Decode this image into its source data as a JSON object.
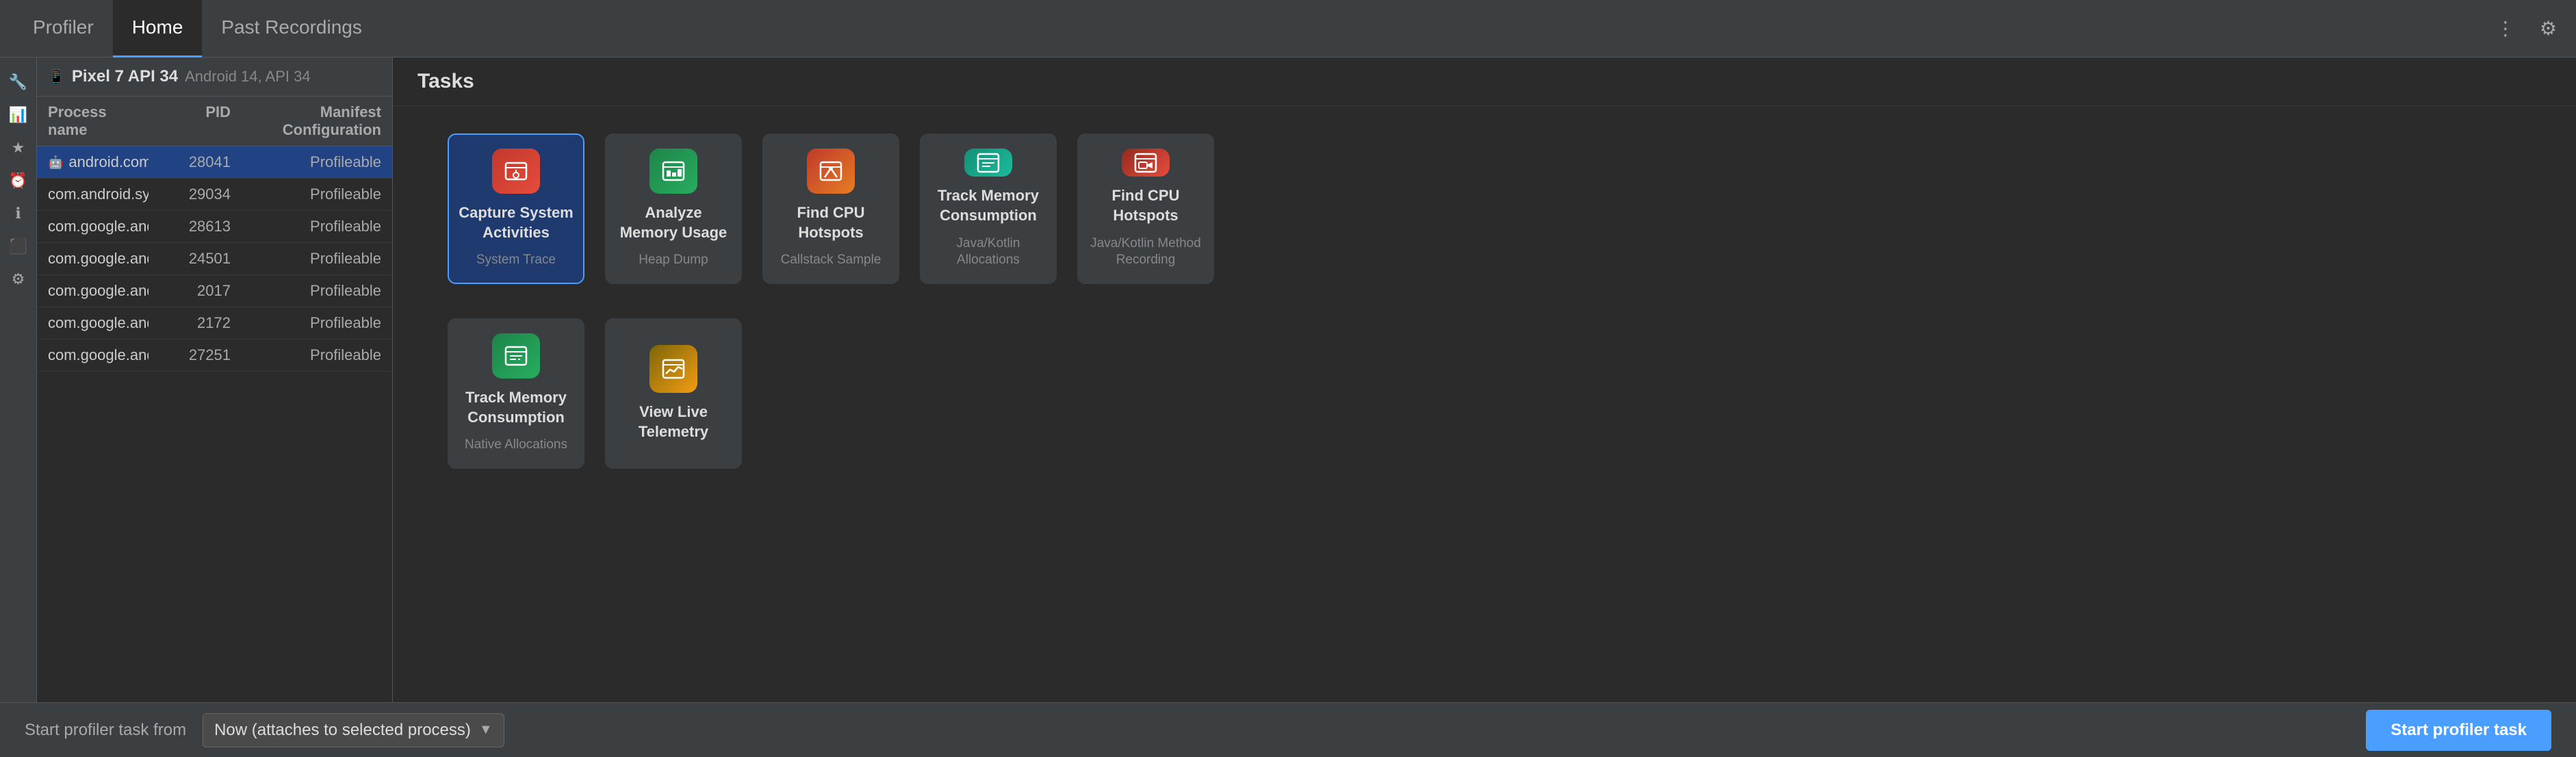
{
  "tabs": [
    {
      "label": "Profiler",
      "id": "profiler",
      "active": false
    },
    {
      "label": "Home",
      "id": "home",
      "active": true
    },
    {
      "label": "Past Recordings",
      "id": "past-recordings",
      "active": false
    }
  ],
  "header_icons": {
    "more": "⋮",
    "settings": "⚙"
  },
  "sidebar_icons": [
    {
      "id": "tool",
      "symbol": "🔧",
      "active": false
    },
    {
      "id": "monitor",
      "symbol": "📊",
      "active": true
    },
    {
      "id": "star",
      "symbol": "★",
      "active": false
    },
    {
      "id": "clock",
      "symbol": "⏰",
      "active": false
    },
    {
      "id": "info",
      "symbol": "ℹ",
      "active": false
    },
    {
      "id": "terminal",
      "symbol": "⬛",
      "active": false
    },
    {
      "id": "settings2",
      "symbol": "⚙",
      "active": false
    }
  ],
  "device": {
    "name": "Pixel 7 API 34",
    "api": "Android 14, API 34",
    "icon": "📱"
  },
  "table_headers": {
    "process_name": "Process name",
    "pid": "PID",
    "manifest": "Manifest Configuration"
  },
  "processes": [
    {
      "name": "android.com.java.profilertester",
      "pid": "28041",
      "manifest": "Profileable",
      "selected": true,
      "has_icon": true
    },
    {
      "name": "com.android.systemui",
      "pid": "29034",
      "manifest": "Profileable",
      "selected": false,
      "has_icon": false
    },
    {
      "name": "com.google.android.apps.messaging",
      "pid": "28613",
      "manifest": "Profileable",
      "selected": false,
      "has_icon": false
    },
    {
      "name": "com.google.android.apps.messaging...",
      "pid": "24501",
      "manifest": "Profileable",
      "selected": false,
      "has_icon": false
    },
    {
      "name": "com.google.android.dialer",
      "pid": "2017",
      "manifest": "Profileable",
      "selected": false,
      "has_icon": false
    },
    {
      "name": "com.google.android.gm",
      "pid": "2172",
      "manifest": "Profileable",
      "selected": false,
      "has_icon": false
    },
    {
      "name": "com.google.android.inputmethod.latin",
      "pid": "27251",
      "manifest": "Profileable",
      "selected": false,
      "has_icon": false
    }
  ],
  "tasks_header": "Tasks",
  "task_cards": [
    {
      "id": "capture-system-activities",
      "title": "Capture System Activities",
      "subtitle": "System Trace",
      "icon_color": "icon-orange",
      "icon_symbol": "📡",
      "selected": true
    },
    {
      "id": "analyze-memory-usage",
      "title": "Analyze Memory Usage",
      "subtitle": "Heap Dump",
      "icon_color": "icon-green",
      "icon_symbol": "🧠",
      "selected": false
    },
    {
      "id": "find-cpu-hotspots-callstack",
      "title": "Find CPU Hotspots",
      "subtitle": "Callstack Sample",
      "icon_color": "icon-red-orange",
      "icon_symbol": "🔥",
      "selected": false
    },
    {
      "id": "track-memory-consumption-java",
      "title": "Track Memory Consumption",
      "subtitle": "Java/Kotlin Allocations",
      "icon_color": "icon-teal",
      "icon_symbol": "📋",
      "selected": false
    },
    {
      "id": "find-cpu-hotspots-recording",
      "title": "Find CPU Hotspots",
      "subtitle": "Java/Kotlin Method Recording",
      "icon_color": "icon-pink",
      "icon_symbol": "📹",
      "selected": false
    },
    {
      "id": "track-memory-consumption-native",
      "title": "Track Memory Consumption",
      "subtitle": "Native Allocations",
      "icon_color": "icon-green",
      "icon_symbol": "📋",
      "selected": false
    },
    {
      "id": "view-live-telemetry",
      "title": "View Live Telemetry",
      "subtitle": "",
      "icon_color": "icon-olive",
      "icon_symbol": "📈",
      "selected": false
    }
  ],
  "bottom_bar": {
    "label": "Start profiler task from",
    "dropdown_value": "Now (attaches to selected process)",
    "dropdown_arrow": "▼",
    "start_button": "Start profiler task"
  }
}
